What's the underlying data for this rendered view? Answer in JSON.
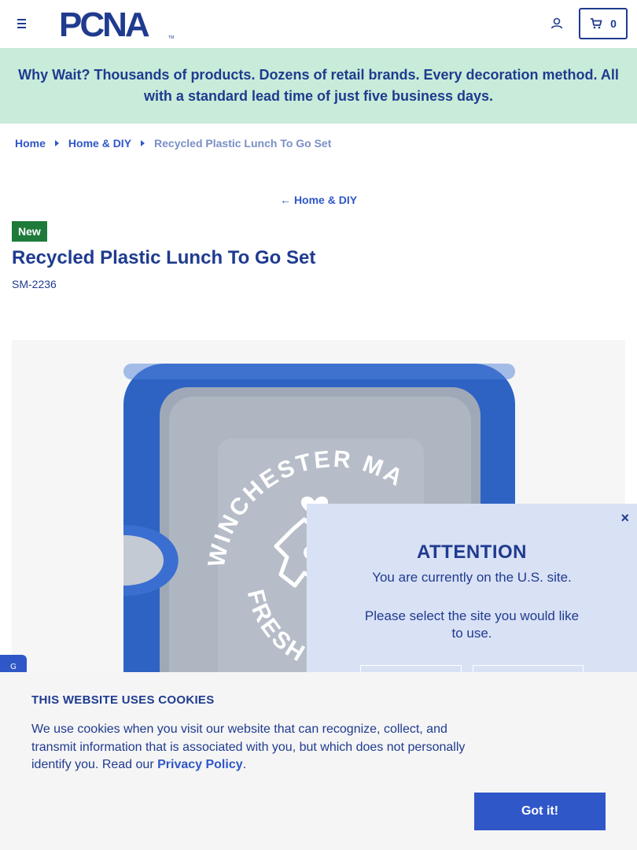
{
  "header": {
    "brand": "PCNA",
    "cart_count": "0"
  },
  "banner": {
    "text": "Why Wait? Thousands of products. Dozens of retail brands. Every decoration method. All with a standard lead time of just five business days."
  },
  "breadcrumb": {
    "items": [
      "Home",
      "Home & DIY"
    ],
    "current": "Recycled Plastic Lunch To Go Set"
  },
  "back_link": "Home & DIY",
  "product": {
    "badge": "New",
    "title": "Recycled Plastic Lunch To Go Set",
    "sku": "SM-2236",
    "imprint_top": "WINCHESTER MA",
    "imprint_bottom": "FRESH A"
  },
  "side_tab": "G",
  "attention": {
    "close": "×",
    "title": "ATTENTION",
    "message": "You are currently on the U.S. site.",
    "prompt": "Please select the site you would like to use."
  },
  "cookie": {
    "title": "THIS WEBSITE USES COOKIES",
    "text_before": "We use cookies when you visit our website that can recognize, collect, and transmit information that is associated with you, but which does not personally identify you. Read our ",
    "link": "Privacy Policy",
    "text_after": ".",
    "button": "Got it!"
  },
  "colors": {
    "brand_navy": "#1f3b8f",
    "link_blue": "#2f57c8",
    "banner_bg": "#c8ecd9",
    "badge_green": "#1e7a3a",
    "popup_bg": "#d9e1f5",
    "container_blue": "#2e63c4"
  }
}
